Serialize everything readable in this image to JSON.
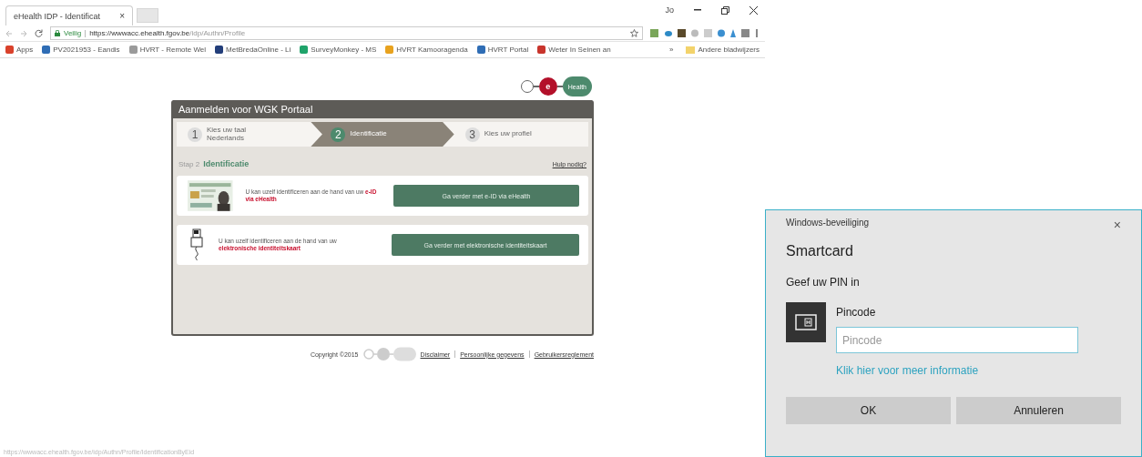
{
  "browser": {
    "tab": {
      "title": "eHealth IDP - Identificat",
      "close": "×"
    },
    "user": "Jo",
    "address": {
      "security": "Veilig",
      "url_host": "https://wwwacc.ehealth.fgov.be",
      "url_path": "/idp/Authn/Profile"
    },
    "bookmarks": [
      {
        "label": "Apps",
        "color": "#d9412b"
      },
      {
        "label": "PV2021953 - Eandis",
        "color": "#2f6db5"
      },
      {
        "label": "HVRT - Remote Wel",
        "color": "#9a9a9a"
      },
      {
        "label": "MetBredaOnline - Li",
        "color": "#233e7a"
      },
      {
        "label": "SurveyMonkey - MS",
        "color": "#1fa36a"
      },
      {
        "label": "HVRT Kamooragenda",
        "color": "#e8a21e"
      },
      {
        "label": "HVRT Portal",
        "color": "#2f6db5"
      },
      {
        "label": "Weter In Seinen an",
        "color": "#c8342c"
      }
    ],
    "more": "»",
    "other_bookmarks": "Andere bladwijzers",
    "status_url": "https://wwwacc.ehealth.fgov.be/idp/Authn/Profile/IdentificationByEid"
  },
  "page": {
    "logo": {
      "letter": "e",
      "word": "Health"
    },
    "panel_title": "Aanmelden voor WGK Portaal",
    "steps": [
      {
        "number": "1",
        "label": "Kies uw taal",
        "sub": "Nederlands",
        "selected": false
      },
      {
        "number": "2",
        "label": "Identificatie",
        "selected": true
      },
      {
        "number": "3",
        "label": "Kies uw profiel",
        "selected": false
      }
    ],
    "step_prefix": "Stap 2",
    "step_title": "Identificatie",
    "help": "Hulp nodig?",
    "options": [
      {
        "kind": "eid-photo",
        "text": "U kan uzelf identificeren aan de hand van uw",
        "highlight": "e-ID via eHealth",
        "button": "Ga verder met e-ID via eHealth"
      },
      {
        "kind": "card-reader",
        "text": "U kan uzelf identificeren aan de hand van uw",
        "highlight": "elektronische identiteitskaart",
        "button": "Ga verder met elektronische identiteitskaart"
      }
    ],
    "footer": {
      "copyright": "Copyright ©2015",
      "links": [
        "Disclaimer",
        "Persoonlijke gegevens",
        "Gebruikersreglement"
      ]
    }
  },
  "dialog": {
    "title": "Windows-beveiliging",
    "close": "×",
    "heading": "Smartcard",
    "prompt": "Geef uw PIN in",
    "field_label": "Pincode",
    "placeholder": "Pincode",
    "link": "Klik hier voor meer informatie",
    "buttons": [
      "OK",
      "Annuleren"
    ]
  }
}
